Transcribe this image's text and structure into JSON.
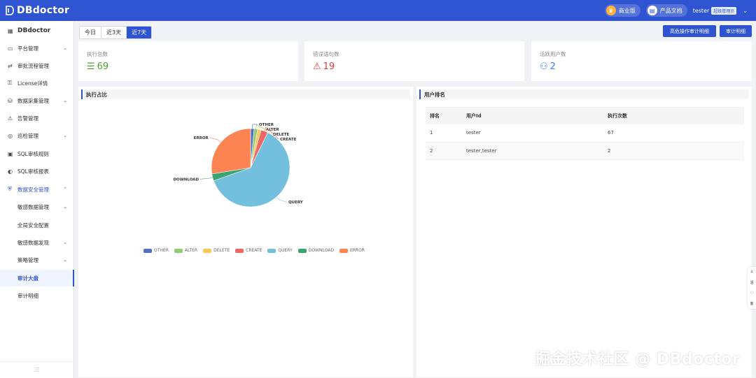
{
  "app": {
    "name": "DBdoctor"
  },
  "topbar": {
    "edition_label": "商业版",
    "docs_label": "产品文档",
    "user_name": "tester",
    "user_role": "超级管理员"
  },
  "sidebar": {
    "title": "DBdoctor",
    "items": [
      {
        "label": "平台管理",
        "icon": "monitor-icon",
        "expandable": true
      },
      {
        "label": "审批流程管理",
        "icon": "flow-icon",
        "expandable": false
      },
      {
        "label": "License详情",
        "icon": "lock-icon",
        "expandable": false
      },
      {
        "label": "数据采集管理",
        "icon": "database-icon",
        "expandable": true
      },
      {
        "label": "告警管理",
        "icon": "alarm-icon",
        "expandable": false
      },
      {
        "label": "巡检管理",
        "icon": "inspect-icon",
        "expandable": true
      },
      {
        "label": "SQL审核规则",
        "icon": "rule-icon",
        "expandable": false
      },
      {
        "label": "SQL审核报表",
        "icon": "report-icon",
        "expandable": false
      },
      {
        "label": "数据安全管理",
        "icon": "shield-icon",
        "expandable": true
      }
    ],
    "sub_items": [
      {
        "label": "敏感数据管理",
        "expandable": true
      },
      {
        "label": "全局安全配置",
        "expandable": false
      },
      {
        "label": "敏感数据发现",
        "expandable": true
      },
      {
        "label": "策略管理",
        "expandable": true
      },
      {
        "label": "审计大盘",
        "expandable": false
      },
      {
        "label": "审计明细",
        "expandable": false
      }
    ]
  },
  "range": {
    "options": [
      "今日",
      "近3天",
      "近7天"
    ],
    "selected": "近7天"
  },
  "actions": {
    "high_risk_label": "高危操作审计明细",
    "audit_detail_label": "审计明细"
  },
  "stats": [
    {
      "label": "执行总数",
      "value": "69",
      "icon": "list-icon",
      "color": "#52a12a"
    },
    {
      "label": "错误语句数",
      "value": "19",
      "icon": "warning-icon",
      "color": "#e0393e"
    },
    {
      "label": "活跃用户数",
      "value": "2",
      "icon": "users-icon",
      "color": "#3b82f6"
    }
  ],
  "pie_panel": {
    "title": "执行占比"
  },
  "chart_data": {
    "type": "pie",
    "slices": [
      {
        "name": "OTHER",
        "value": 1,
        "color": "#5470c6"
      },
      {
        "name": "ALTER",
        "value": 1,
        "color": "#91cc75"
      },
      {
        "name": "DELETE",
        "value": 1,
        "color": "#fac858"
      },
      {
        "name": "CREATE",
        "value": 2,
        "color": "#ee6666"
      },
      {
        "name": "QUERY",
        "value": 43,
        "color": "#73c0de"
      },
      {
        "name": "DOWNLOAD",
        "value": 2,
        "color": "#3ba272"
      },
      {
        "name": "ERROR",
        "value": 19,
        "color": "#fc8452"
      }
    ],
    "legend_position": "bottom"
  },
  "user_panel": {
    "title": "用户排名",
    "columns": [
      "排名",
      "用户Id",
      "执行次数"
    ],
    "rows": [
      [
        "1",
        "tester",
        "67"
      ],
      [
        "2",
        "tester,tester",
        "2"
      ]
    ]
  },
  "float_tab": {
    "items": [
      "活",
      "客"
    ]
  },
  "watermark": "掘金技术社区 @ DBdoctor"
}
